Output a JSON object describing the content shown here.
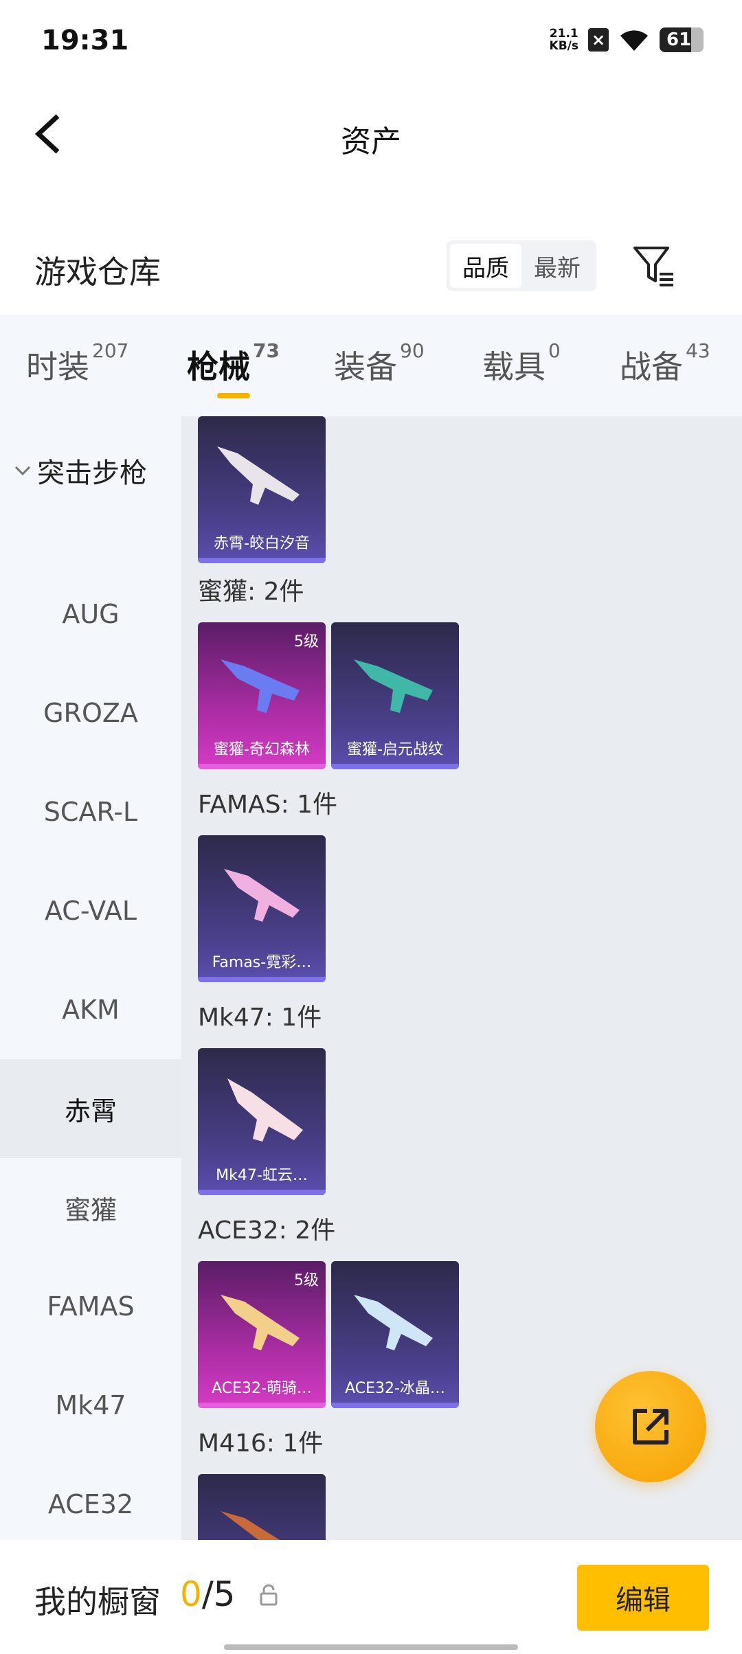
{
  "status": {
    "time": "19:31",
    "net_speed_value": "21.1",
    "net_speed_unit": "KB/s",
    "battery": "61"
  },
  "header": {
    "title": "资产"
  },
  "section": {
    "title": "游戏仓库",
    "sort_quality": "品质",
    "sort_latest": "最新"
  },
  "tabs": [
    {
      "label": "时装",
      "count": "207"
    },
    {
      "label": "枪械",
      "count": "73"
    },
    {
      "label": "装备",
      "count": "90"
    },
    {
      "label": "载具",
      "count": "0"
    },
    {
      "label": "战备",
      "count": "43"
    }
  ],
  "sidebar": {
    "group": "突击步枪",
    "items": [
      "AUG",
      "GROZA",
      "SCAR-L",
      "AC-VAL",
      "AKM",
      "赤霄",
      "蜜獾",
      "FAMAS",
      "Mk47",
      "ACE32"
    ],
    "active": "赤霄"
  },
  "groups": [
    {
      "label": "",
      "items": [
        {
          "name": "赤霄-皎白汐音",
          "level": "",
          "rarity": "purple"
        }
      ]
    },
    {
      "label": "蜜獾: 2件",
      "items": [
        {
          "name": "蜜獾-奇幻森林",
          "level": "5级",
          "rarity": "pink"
        },
        {
          "name": "蜜獾-启元战纹",
          "level": "",
          "rarity": "purple"
        }
      ]
    },
    {
      "label": "FAMAS: 1件",
      "items": [
        {
          "name": "Famas-霓彩…",
          "level": "",
          "rarity": "purple"
        }
      ]
    },
    {
      "label": "Mk47: 1件",
      "items": [
        {
          "name": "Mk47-虹云…",
          "level": "",
          "rarity": "purple"
        }
      ]
    },
    {
      "label": "ACE32: 2件",
      "items": [
        {
          "name": "ACE32-萌骑…",
          "level": "5级",
          "rarity": "pink"
        },
        {
          "name": "ACE32-冰晶…",
          "level": "",
          "rarity": "purple"
        }
      ]
    },
    {
      "label": "M416: 1件",
      "items": [
        {
          "name": "",
          "level": "",
          "rarity": "purple"
        }
      ]
    }
  ],
  "bottom": {
    "showcase_label": "我的橱窗",
    "current": "0",
    "sep_total": "/5",
    "edit_label": "编辑"
  },
  "colors": {
    "accent": "#f5b300",
    "purple_card": "#5b4fb0",
    "pink_card": "#d43cc4"
  }
}
